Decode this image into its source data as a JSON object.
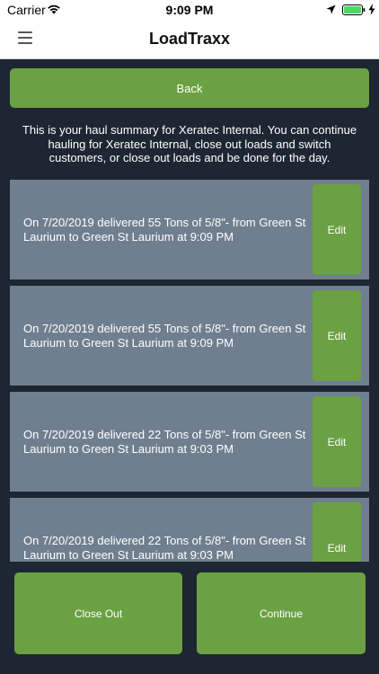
{
  "status_bar": {
    "carrier": "Carrier",
    "time": "9:09 PM",
    "icons": [
      "wifi-icon",
      "location-icon",
      "battery-icon",
      "charging-icon"
    ]
  },
  "nav": {
    "title": "LoadTraxx",
    "menu_icon": "hamburger-menu-icon"
  },
  "back_label": "Back",
  "summary": "This is your haul summary for Xeratec Internal.  You can continue hauling for Xeratec Internal,  close out loads and switch customers, or close out loads and be done for the day.",
  "loads": [
    {
      "text": "On 7/20/2019 delivered 55 Tons of 5/8\"- from Green St Laurium to Green St Laurium at 9:09 PM",
      "edit_label": "Edit"
    },
    {
      "text": "On 7/20/2019 delivered 55 Tons of 5/8\"- from Green St Laurium to Green St Laurium at 9:09 PM",
      "edit_label": "Edit"
    },
    {
      "text": "On 7/20/2019 delivered 22 Tons of 5/8\"- from Green St Laurium to Green St Laurium at 9:03 PM",
      "edit_label": "Edit"
    },
    {
      "text": "On 7/20/2019 delivered 22 Tons of 5/8\"- from Green St Laurium to Green St Laurium at 9:03 PM",
      "edit_label": "Edit"
    }
  ],
  "footer": {
    "close_out_label": "Close Out",
    "continue_label": "Continue"
  },
  "colors": {
    "accent_green": "#6aa142",
    "card_gray": "#707f8f",
    "background": "#1e2633"
  }
}
